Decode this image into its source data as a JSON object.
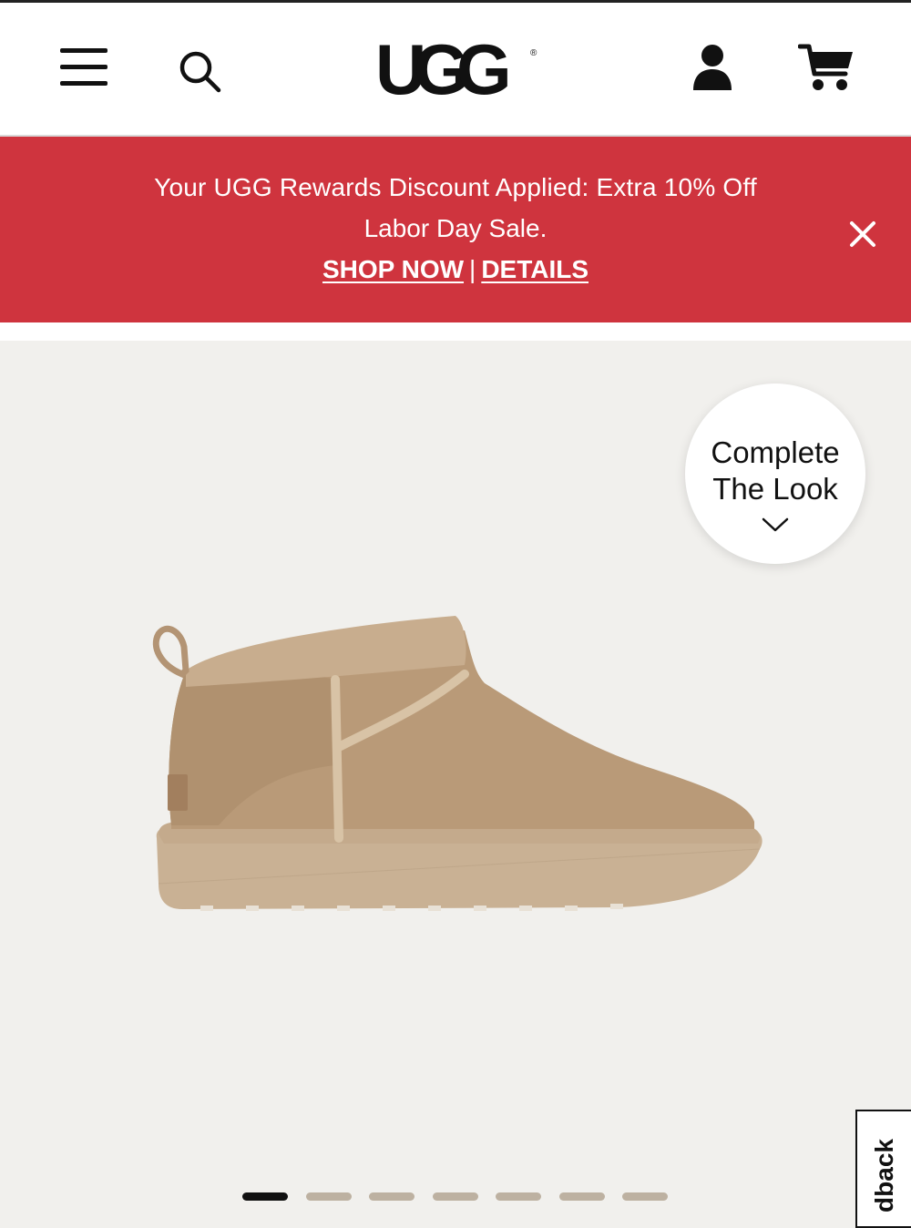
{
  "header": {
    "logo_text": "UGG",
    "menu_icon": "hamburger-menu-icon",
    "search_icon": "search-icon",
    "account_icon": "account-icon",
    "cart_icon": "cart-icon"
  },
  "promo": {
    "line1": "Your UGG Rewards Discount Applied: Extra 10% Off",
    "line2": "Labor Day Sale.",
    "shop_now": "SHOP NOW",
    "separator": "|",
    "details": "DETAILS",
    "close_icon": "close-icon",
    "bg_color": "#cf343e"
  },
  "complete_the_look": {
    "line1": "Complete",
    "line2": "The Look",
    "icon": "chevron-down-icon"
  },
  "gallery": {
    "slide_count": 7,
    "active_index": 0
  },
  "feedback_tab": {
    "label": "Feedback",
    "visible_label": "dback"
  }
}
